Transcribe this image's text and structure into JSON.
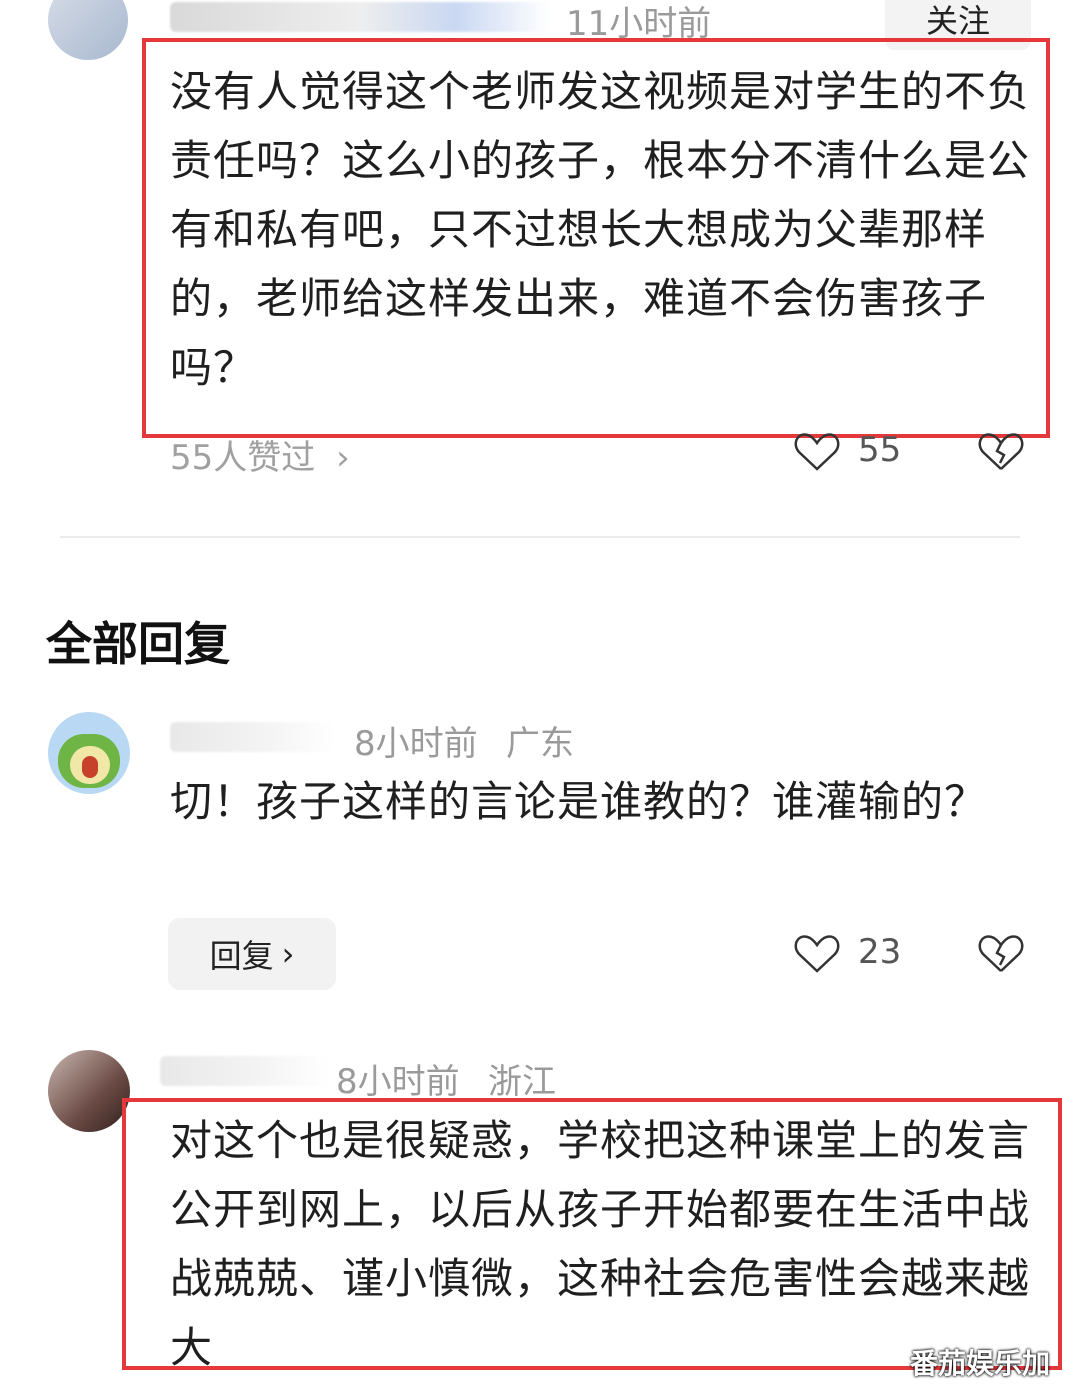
{
  "top_comment": {
    "time": "11小时前",
    "follow_label": "关注",
    "text": "没有人觉得这个老师发这视频是对学生的不负责任吗？这么小的孩子，根本分不清什么是公有和私有吧，只不过想长大想成为父辈那样的，老师给这样发出来，难道不会伤害孩子吗？",
    "liked_by": "55人赞过",
    "like_count": "55"
  },
  "section_title": "全部回复",
  "replies": [
    {
      "time": "8小时前",
      "location": "广东",
      "text": "切！孩子这样的言论是谁教的？谁灌输的？",
      "reply_label": "回复",
      "like_count": "23"
    },
    {
      "time": "8小时前",
      "location": "浙江",
      "text": "对这个也是很疑惑，学校把这种课堂上的发言公开到网上，以后从孩子开始都要在生活中战战兢兢、谨小慎微，这种社会危害性会越来越大"
    }
  ],
  "watermark": "番茄娱乐加",
  "colors": {
    "highlight_border": "#e5383b",
    "meta_gray": "#9a9a9a"
  }
}
